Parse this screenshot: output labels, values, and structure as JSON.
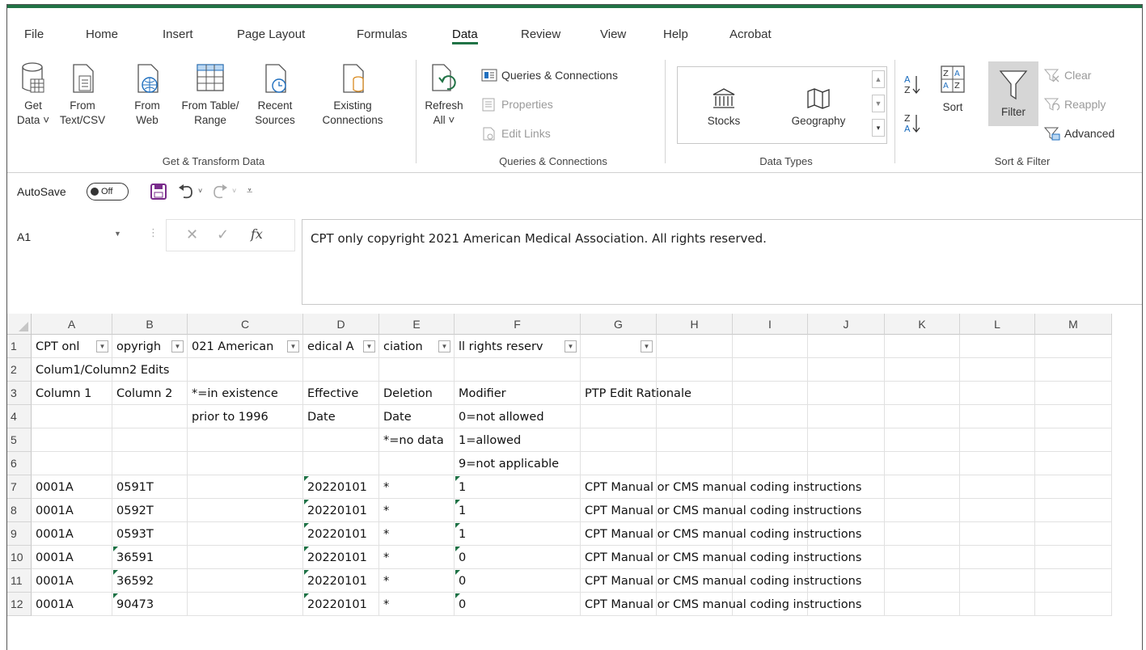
{
  "ribbon_tabs": [
    "File",
    "Home",
    "Insert",
    "Page Layout",
    "Formulas",
    "Data",
    "Review",
    "View",
    "Help",
    "Acrobat"
  ],
  "active_tab": "Data",
  "get_transform": {
    "get_data": [
      "Get",
      "Data ˅"
    ],
    "from_text_csv": [
      "From",
      "Text/CSV"
    ],
    "from_web": [
      "From",
      "Web"
    ],
    "from_table_range": [
      "From Table/",
      "Range"
    ],
    "recent_sources": [
      "Recent",
      "Sources"
    ],
    "existing_connections": [
      "Existing",
      "Connections"
    ],
    "group_label": "Get & Transform Data"
  },
  "queries": {
    "refresh_all": [
      "Refresh",
      "All ˅"
    ],
    "queries_connections": "Queries & Connections",
    "properties": "Properties",
    "edit_links": "Edit Links",
    "group_label": "Queries & Connections"
  },
  "data_types": {
    "stocks": "Stocks",
    "geography": "Geography",
    "group_label": "Data Types"
  },
  "sort_filter": {
    "sort": "Sort",
    "filter": "Filter",
    "clear": "Clear",
    "reapply": "Reapply",
    "advanced": "Advanced",
    "group_label": "Sort & Filter"
  },
  "qat": {
    "autosave": "AutoSave",
    "toggle": "Off"
  },
  "formula_bar": {
    "name_box": "A1",
    "fx": "fx",
    "content": "CPT only copyright 2021 American Medical Association.  All rights reserved."
  },
  "columns": [
    "A",
    "B",
    "C",
    "D",
    "E",
    "F",
    "G",
    "H",
    "I",
    "J",
    "K",
    "L",
    "M"
  ],
  "rows": [
    {
      "n": "1",
      "a": "CPT onl",
      "b": "opyrigh",
      "c": "021 American",
      "d": "edical A",
      "e": "ciation",
      "f": "ll rights reserv",
      "g": "",
      "rationale": ""
    },
    {
      "n": "2",
      "a": "Colum1/Column2 Edits",
      "b": "",
      "c": "",
      "d": "",
      "e": "",
      "f": "",
      "g": "",
      "rationale": ""
    },
    {
      "n": "3",
      "a": "Column 1",
      "b": "Column 2",
      "c": "*=in existence",
      "d": "Effective",
      "e": "Deletion",
      "f": "Modifier",
      "g": "PTP Edit Rationale",
      "rationale": ""
    },
    {
      "n": "4",
      "a": "",
      "b": "",
      "c": "prior to 1996",
      "d": "Date",
      "e": "Date",
      "f": "0=not allowed",
      "g": "",
      "rationale": ""
    },
    {
      "n": "5",
      "a": "",
      "b": "",
      "c": "",
      "d": "",
      "e": "*=no data",
      "f": "1=allowed",
      "g": "",
      "rationale": ""
    },
    {
      "n": "6",
      "a": "",
      "b": "",
      "c": "",
      "d": "",
      "e": "",
      "f": "9=not applicable",
      "g": "",
      "rationale": ""
    },
    {
      "n": "7",
      "a": "0001A",
      "b": "0591T",
      "c": "",
      "d": "20220101",
      "e": "*",
      "f": "1",
      "g": "CPT Manual or CMS manual coding instructions"
    },
    {
      "n": "8",
      "a": "0001A",
      "b": "0592T",
      "c": "",
      "d": "20220101",
      "e": "*",
      "f": "1",
      "g": "CPT Manual or CMS manual coding instructions"
    },
    {
      "n": "9",
      "a": "0001A",
      "b": "0593T",
      "c": "",
      "d": "20220101",
      "e": "*",
      "f": "1",
      "g": "CPT Manual or CMS manual coding instructions"
    },
    {
      "n": "10",
      "a": "0001A",
      "b": "36591",
      "c": "",
      "d": "20220101",
      "e": "*",
      "f": "0",
      "g": "CPT Manual or CMS manual coding instructions"
    },
    {
      "n": "11",
      "a": "0001A",
      "b": "36592",
      "c": "",
      "d": "20220101",
      "e": "*",
      "f": "0",
      "g": "CPT Manual or CMS manual coding instructions"
    },
    {
      "n": "12",
      "a": "0001A",
      "b": "90473",
      "c": "",
      "d": "20220101",
      "e": "*",
      "f": "0",
      "g": "CPT Manual or CMS manual coding instructions"
    }
  ],
  "colors": {
    "accent": "#217346",
    "filter_active": "#d6d6d6"
  }
}
